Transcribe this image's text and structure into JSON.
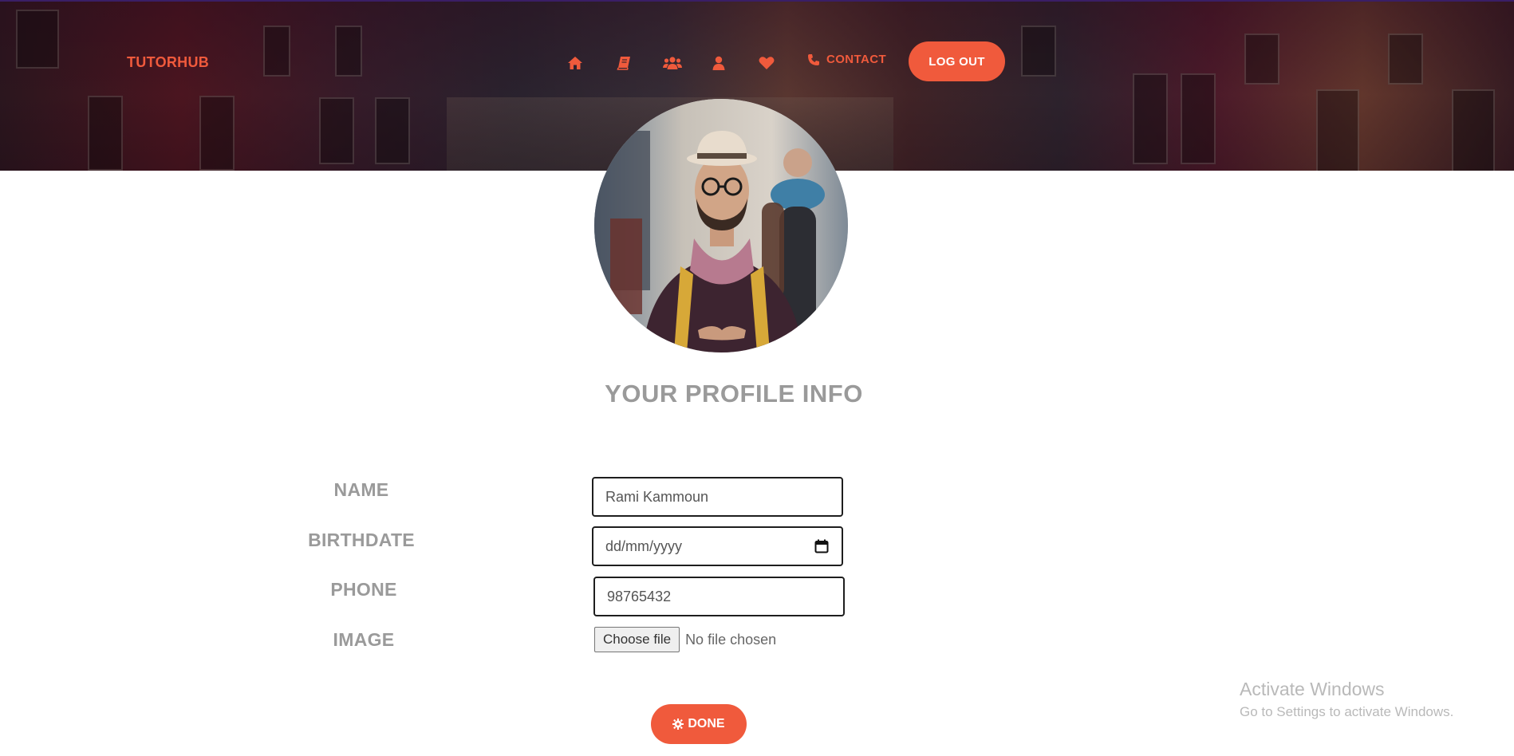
{
  "header": {
    "brand": "TUTORHUB",
    "nav_icons": [
      "home-icon",
      "book-icon",
      "users-icon",
      "user-icon",
      "heart-icon"
    ],
    "contact_label": "CONTACT",
    "logout_label": "LOG OUT"
  },
  "profile": {
    "title": "YOUR PROFILE INFO",
    "fields": {
      "name": {
        "label": "NAME",
        "value": "Rami Kammoun"
      },
      "birthdate": {
        "label": "BIRTHDATE",
        "placeholder": "dd/mm/yyyy"
      },
      "phone": {
        "label": "PHONE",
        "value": "98765432"
      },
      "image": {
        "label": "IMAGE",
        "button": "Choose file",
        "status": "No file chosen"
      }
    },
    "done_label": "DONE"
  },
  "watermark": {
    "title": "Activate Windows",
    "subtitle": "Go to Settings to activate Windows."
  },
  "colors": {
    "accent": "#f05a3c",
    "label_gray": "#9a9a9a"
  }
}
